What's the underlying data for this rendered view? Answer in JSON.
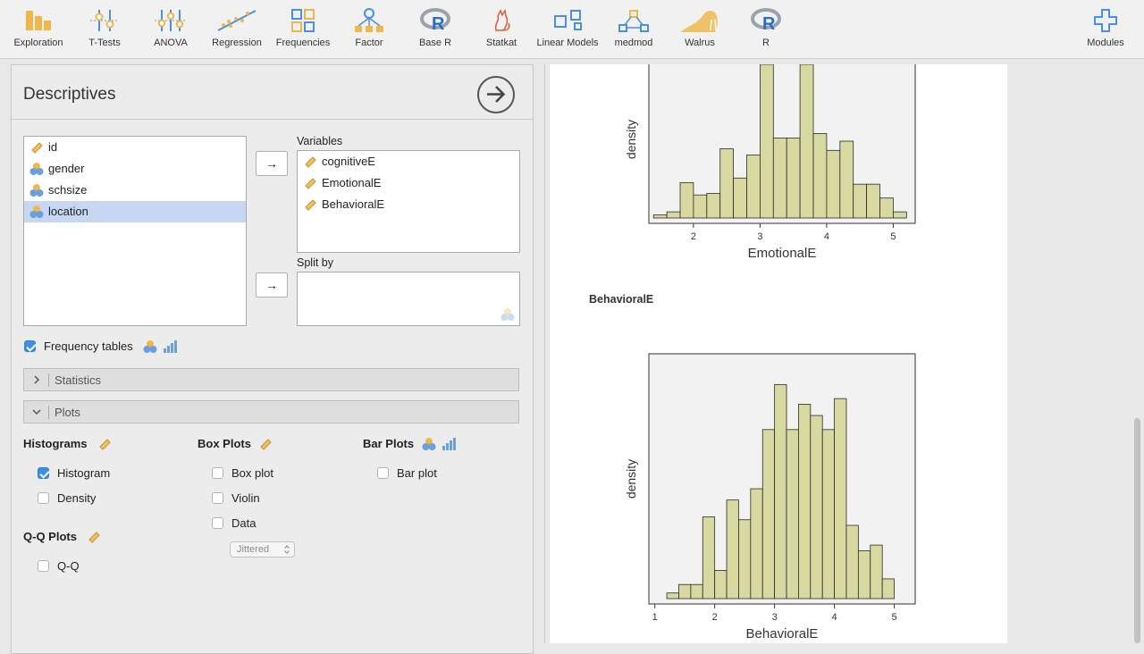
{
  "toolbar": {
    "items": [
      {
        "label": "Exploration",
        "icon": "exploration-icon"
      },
      {
        "label": "T-Tests",
        "icon": "t-tests-icon"
      },
      {
        "label": "ANOVA",
        "icon": "anova-icon"
      },
      {
        "label": "Regression",
        "icon": "regression-icon"
      },
      {
        "label": "Frequencies",
        "icon": "frequencies-icon"
      },
      {
        "label": "Factor",
        "icon": "factor-icon"
      },
      {
        "label": "Base R",
        "icon": "r-logo-icon"
      },
      {
        "label": "Statkat",
        "icon": "statkat-icon"
      },
      {
        "label": "Linear Models",
        "icon": "linear-models-icon"
      },
      {
        "label": "medmod",
        "icon": "medmod-icon"
      },
      {
        "label": "Walrus",
        "icon": "walrus-icon"
      },
      {
        "label": "R",
        "icon": "r-logo-icon"
      }
    ],
    "modules_label": "Modules"
  },
  "panel": {
    "title": "Descriptives",
    "variables_list": [
      {
        "name": "id",
        "type": "continuous",
        "selected": false
      },
      {
        "name": "gender",
        "type": "nominal",
        "selected": false
      },
      {
        "name": "schsize",
        "type": "nominal",
        "selected": false
      },
      {
        "name": "location",
        "type": "nominal",
        "selected": true
      }
    ],
    "variables_label": "Variables",
    "variables_target": [
      "cognitiveE",
      "EmotionalE",
      "BehavioralE"
    ],
    "split_by_label": "Split by",
    "move_arrow": "→",
    "frequency_tables_label": "Frequency tables",
    "frequency_tables_checked": true,
    "statistics_label": "Statistics",
    "plots_label": "Plots",
    "histograms_label": "Histograms",
    "histogram_label": "Histogram",
    "histogram_checked": true,
    "density_label": "Density",
    "density_checked": false,
    "box_plots_label": "Box Plots",
    "box_plot_label": "Box plot",
    "violin_label": "Violin",
    "data_label": "Data",
    "jitter_value": "Jittered",
    "bar_plots_label": "Bar Plots",
    "bar_plot_label": "Bar plot",
    "qq_plots_label": "Q-Q Plots",
    "qq_label": "Q-Q"
  },
  "results": {
    "section_heading": "BehavioralE"
  },
  "colors": {
    "bar_fill": "#d8d8a1",
    "bar_stroke": "#2b2b2b",
    "plot_bg": "#f2f2f2",
    "accent": "#3d8ee6",
    "icon_blue": "#4a90e2",
    "icon_orange": "#f0b64a"
  },
  "chart_data": [
    {
      "type": "bar",
      "xlabel": "EmotionalE",
      "ylabel": "density",
      "xlim": [
        1.33,
        5.33
      ],
      "xticks": [
        2,
        3,
        4,
        5
      ],
      "ylim": [
        0,
        1
      ],
      "bin_width": 0.2,
      "bin_starts": [
        1.4,
        1.6,
        1.8,
        2.0,
        2.2,
        2.4,
        2.6,
        2.8,
        3.0,
        3.2,
        3.4,
        3.6,
        3.8,
        4.0,
        4.2,
        4.4,
        4.6,
        4.8
      ],
      "values": [
        0.02,
        0.04,
        0.23,
        0.15,
        0.16,
        0.45,
        0.26,
        0.41,
        1.0,
        0.52,
        0.52,
        1.0,
        0.55,
        0.44,
        0.5,
        0.22,
        0.22,
        0.13,
        0.04
      ],
      "bins_note": ""
    },
    {
      "type": "bar",
      "xlabel": "BehavioralE",
      "ylabel": "density",
      "xlim": [
        0.9,
        5.35
      ],
      "xticks": [
        1,
        2,
        3,
        4,
        5
      ],
      "ylim": [
        0,
        0.85
      ],
      "bin_width": 0.2,
      "bin_starts": [
        1.2,
        1.4,
        1.6,
        1.8,
        2.0,
        2.2,
        2.4,
        2.6,
        2.8,
        3.0,
        3.2,
        3.4,
        3.6,
        3.8,
        4.0,
        4.2,
        4.4,
        4.6,
        4.8,
        5.0
      ],
      "values": [
        0.02,
        0.05,
        0.05,
        0.29,
        0.1,
        0.35,
        0.28,
        0.39,
        0.6,
        0.76,
        0.6,
        0.69,
        0.65,
        0.6,
        0.71,
        0.26,
        0.17,
        0.19,
        0.07
      ]
    }
  ]
}
